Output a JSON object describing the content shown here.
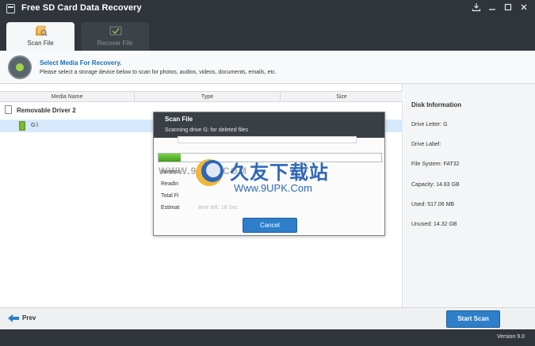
{
  "window": {
    "title": "Free SD Card Data Recovery",
    "controls": [
      "download",
      "minimize",
      "restore",
      "close"
    ]
  },
  "tabs": [
    {
      "label": "Scan File",
      "active": true,
      "icon": "scan-file-icon"
    },
    {
      "label": "Recover File",
      "active": false,
      "icon": "recover-file-icon"
    }
  ],
  "info": {
    "heading": "Select Media For Recovery.",
    "description": "Please select a storage device below to scan for photos, audios, videos, documents, emails, etc."
  },
  "grid": {
    "columns": [
      "Media Name",
      "Type",
      "Size"
    ],
    "group": "Removable Driver 2",
    "drive": "G:\\"
  },
  "disk_info": {
    "heading": "Disk Information",
    "letter": "Drive Letter: G",
    "label": "Drive Label:",
    "fs": "File System: FAT32",
    "capacity": "Capacity: 14.83 GB",
    "used": "Used: 517.06 MB",
    "unused": "Unused: 14.32 GB"
  },
  "dialog": {
    "title": "Scan File",
    "subtitle": "Scanning drive G: for deleted files",
    "progress_fraction": 0.1,
    "fields": [
      {
        "label": "Interest",
        "value": ""
      },
      {
        "label": "Readin",
        "value": ""
      },
      {
        "label": "Total Fi",
        "value": ""
      },
      {
        "label": "Estimat",
        "value": "time left: 18 Sec"
      }
    ],
    "cancel": "Cancel"
  },
  "watermark": {
    "url_left": "WWW.9UPK.COM",
    "cn": "久友下载站",
    "url_right": "Www.9UPK.Com"
  },
  "footer": {
    "prev": "Prev",
    "start": "Start Scan",
    "version": "Version 9.0"
  },
  "colors": {
    "chrome": "#2f353b",
    "accent": "#2d7fc9",
    "selection": "#d6e8fb",
    "progress": "#5cb830"
  }
}
